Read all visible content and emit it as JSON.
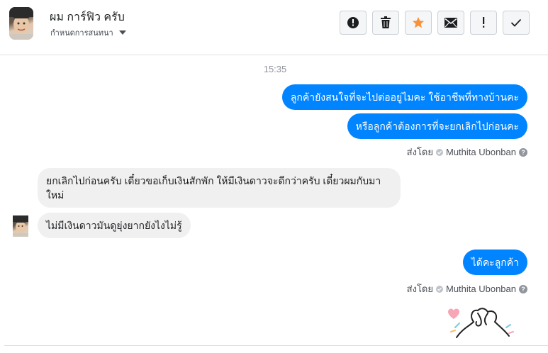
{
  "header": {
    "contact_name": "ผม การ์ฟิว ครับ",
    "manage_label": "กำหนดการสนทนา",
    "toolbar": [
      {
        "icon": "alert-circle-icon",
        "label": ""
      },
      {
        "icon": "trash-icon",
        "label": ""
      },
      {
        "icon": "star-icon",
        "label": ""
      },
      {
        "icon": "envelope-icon",
        "label": ""
      },
      {
        "icon": "exclamation-icon",
        "label": ""
      },
      {
        "icon": "check-icon",
        "label": ""
      }
    ]
  },
  "chat": {
    "timestamp": "15:35",
    "outgoing_1": "ลูกค้ายังสนใจที่จะไปต่ออยู่ไมคะ ใช้อาชีพที่ทางบ้านคะ",
    "outgoing_2": "หรือลูกค้าต้องการที่จะยกเลิกไปก่อนคะ",
    "sent_by_label": "ส่งโดย",
    "sent_by_name": "Muthita Ubonban",
    "incoming_1": "ยกเลิกไปก่อนครับ เดี๋ยวขอเก็บเงินสักพัก ให้มีเงินดาวจะดีกว่าครับ เดี๋ยวผมกับมาใหม่",
    "incoming_2": "ไม่มีเงินดาวมันดูยุ่งยากยังไงไม่รู้",
    "outgoing_3": "ได้คะลูกค้า",
    "help_glyph": "?"
  },
  "colors": {
    "accent": "#0084ff",
    "incoming_bg": "#f1f0f0",
    "star": "#f7923a"
  }
}
